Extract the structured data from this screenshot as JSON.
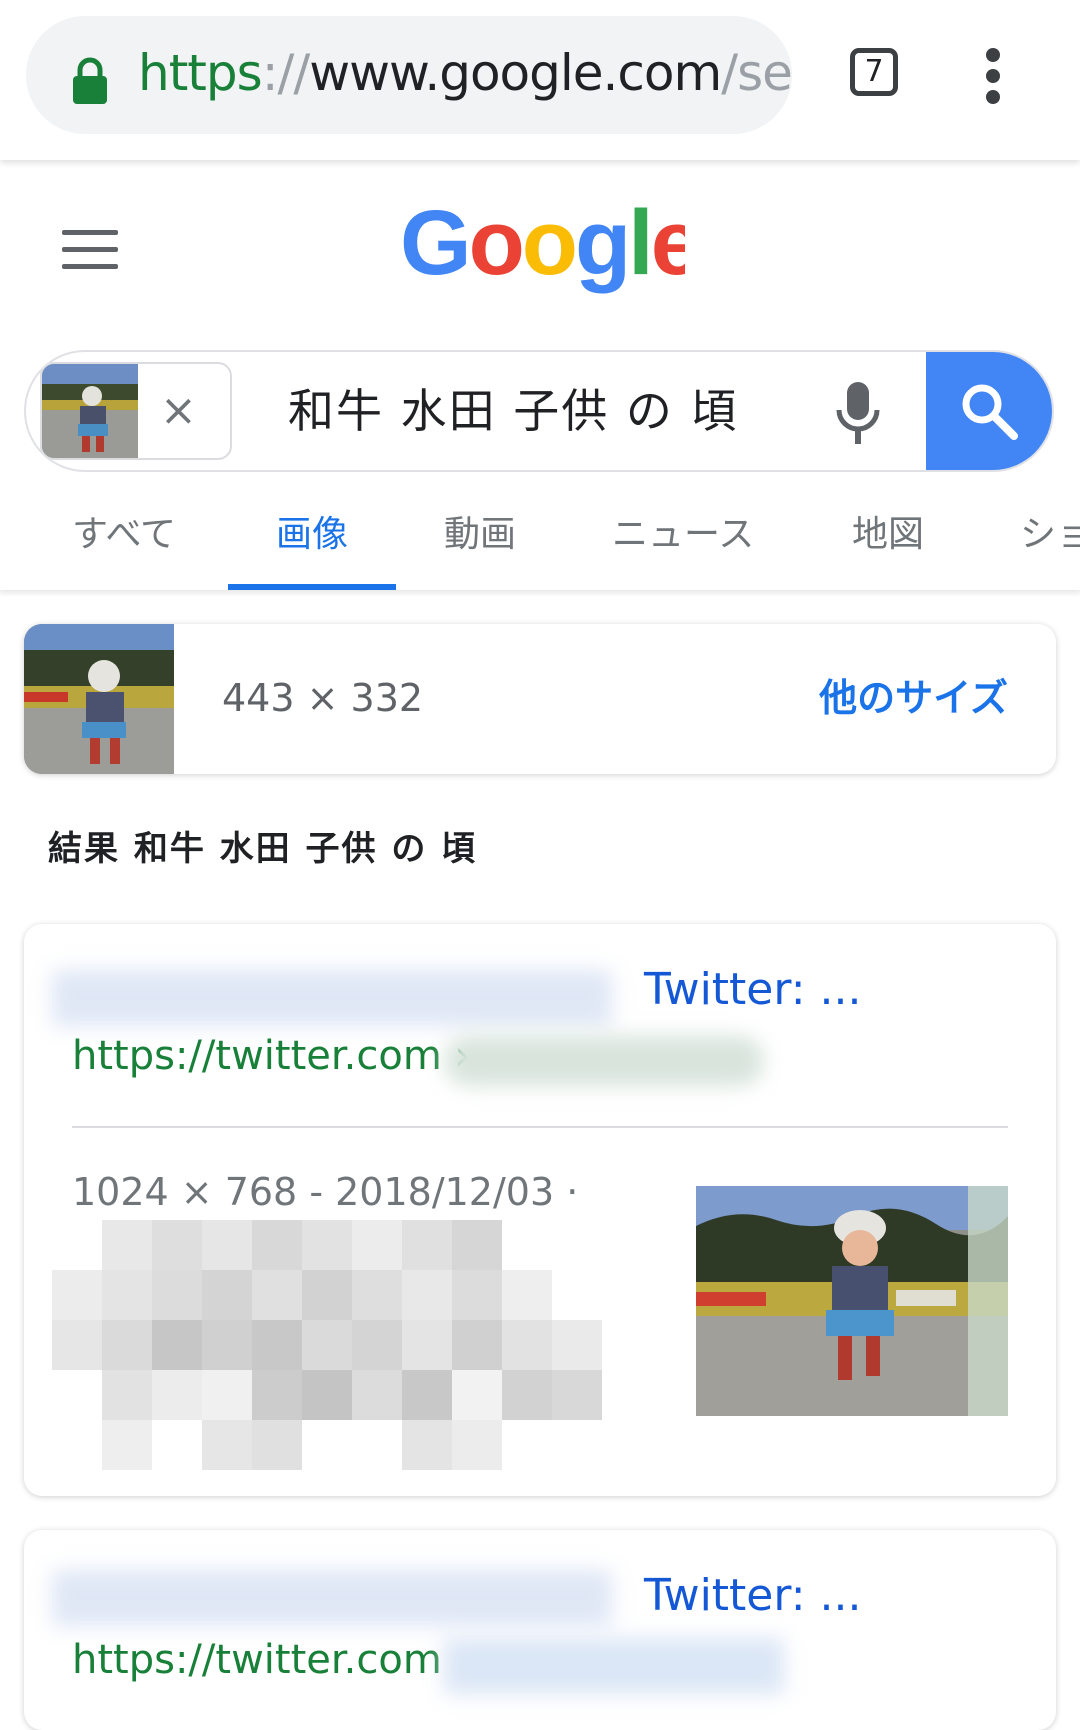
{
  "browser": {
    "url_scheme": "https",
    "url_sep": "://",
    "url_host": "www.google.com",
    "url_path": "/sea",
    "tab_count": "7"
  },
  "search": {
    "query": "和牛 水田 子供 の 頃",
    "clear_symbol": "×"
  },
  "tabs": [
    {
      "label": "すべて"
    },
    {
      "label": "画像"
    },
    {
      "label": "動画"
    },
    {
      "label": "ニュース"
    },
    {
      "label": "地図"
    },
    {
      "label": "ショ"
    }
  ],
  "active_tab": "画像",
  "image_info": {
    "size": "443 × 332",
    "more_sizes": "他のサイズ"
  },
  "results_heading": "結果 和牛 水田 子供 の 頃",
  "results": [
    {
      "title": "Twitter: ...",
      "url": "https://twitter.com ›",
      "meta": "1024 × 768 - 2018/12/03 ·"
    },
    {
      "title": "Twitter: ...",
      "url": "https://twitter.com"
    }
  ],
  "colors": {
    "accent": "#1a73e8",
    "url_green": "#188038",
    "search_button": "#4285f4"
  }
}
